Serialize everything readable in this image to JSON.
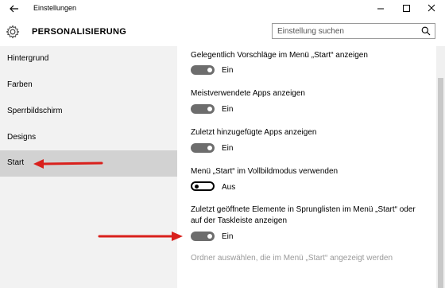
{
  "window": {
    "title": "Einstellungen"
  },
  "header": {
    "section_title": "PERSONALISIERUNG",
    "search_placeholder": "Einstellung suchen"
  },
  "sidebar": {
    "items": [
      {
        "label": "Hintergrund"
      },
      {
        "label": "Farben"
      },
      {
        "label": "Sperrbildschirm"
      },
      {
        "label": "Designs"
      },
      {
        "label": "Start",
        "selected": true
      }
    ]
  },
  "options": [
    {
      "label": "Gelegentlich Vorschläge im Menü „Start“ anzeigen",
      "state": "Ein",
      "on": true
    },
    {
      "label": "Meistverwendete Apps anzeigen",
      "state": "Ein",
      "on": true
    },
    {
      "label": "Zuletzt hinzugefügte Apps anzeigen",
      "state": "Ein",
      "on": true
    },
    {
      "label": "Menü „Start“ im Vollbildmodus verwenden",
      "state": "Aus",
      "on": false
    },
    {
      "label_line1": "Zuletzt geöffnete Elemente in Sprunglisten im Menü „Start“ oder",
      "label_line2": "auf der Taskleiste anzeigen",
      "state": "Ein",
      "on": true
    }
  ],
  "folders_link": "Ordner auswählen, die im Menü „Start“ angezeigt werden",
  "colors": {
    "annotation_arrow": "#d9201c",
    "toggle_on": "#6d6d6d",
    "sidebar_bg": "#f2f2f2",
    "sidebar_selected": "#d2d2d2"
  },
  "icons": [
    "back-arrow-icon",
    "gear-icon",
    "search-icon",
    "minimize-icon",
    "maximize-icon",
    "close-icon"
  ]
}
